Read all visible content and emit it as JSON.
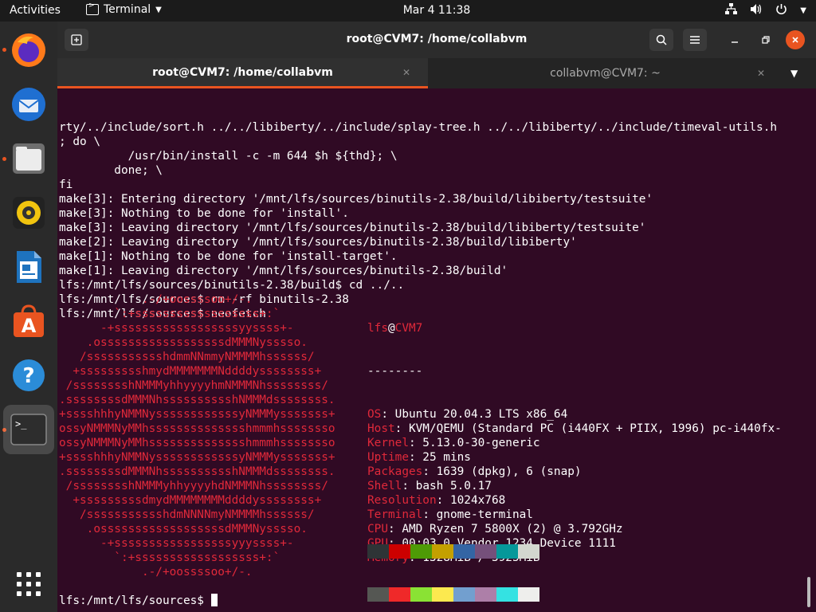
{
  "topbar": {
    "activities": "Activities",
    "app_name": "Terminal",
    "clock": "Mar 4  11:38",
    "tray_icons": [
      "network-icon",
      "volume-icon",
      "power-icon",
      "chevron-down-icon"
    ]
  },
  "dock": {
    "apps": [
      "firefox",
      "thunderbird",
      "files",
      "rhythmbox",
      "libreoffice-writer",
      "software",
      "help",
      "terminal",
      "show-applications"
    ]
  },
  "window": {
    "title": "root@CVM7: /home/collabvm",
    "tabs": [
      {
        "label": "root@CVM7: /home/collabvm",
        "active": true
      },
      {
        "label": "collabvm@CVM7: ~",
        "active": false
      }
    ]
  },
  "terminal": {
    "lines": [
      "rty/../include/sort.h ../../libiberty/../include/splay-tree.h ../../libiberty/../include/timeval-utils.h",
      "; do \\",
      "          /usr/bin/install -c -m 644 $h ${thd}; \\",
      "        done; \\",
      "fi",
      "make[3]: Entering directory '/mnt/lfs/sources/binutils-2.38/build/libiberty/testsuite'",
      "make[3]: Nothing to be done for 'install'.",
      "make[3]: Leaving directory '/mnt/lfs/sources/binutils-2.38/build/libiberty/testsuite'",
      "make[2]: Leaving directory '/mnt/lfs/sources/binutils-2.38/build/libiberty'",
      "make[1]: Nothing to be done for 'install-target'.",
      "make[1]: Leaving directory '/mnt/lfs/sources/binutils-2.38/build'",
      "lfs:/mnt/lfs/sources/binutils-2.38/build$ cd ../..",
      "lfs:/mnt/lfs/sources$ rm -rf binutils-2.38",
      "lfs:/mnt/lfs/sources$ neofetch"
    ],
    "art": [
      "            .-/+oossssoo+/-.",
      "        `:+ssssssssssssssssss+:`",
      "      -+ssssssssssssssssssyyssss+-",
      "    .ossssssssssssssssssdMMMNysssso.",
      "   /ssssssssssshdmmNNmmyNMMMMhssssss/",
      "  +ssssssssshmydMMMMMMMNddddyssssssss+",
      " /sssssssshNMMMyhhyyyyhmNMMMNhssssssss/",
      ".ssssssssdMMMNhsssssssssshNMMMdssssssss.",
      "+sssshhhyNMMNyssssssssssssyNMMMysssssss+",
      "ossyNMMMNyMMhsssssssssssssshmmmhssssssso",
      "ossyNMMMNyMMhsssssssssssssshmmmhssssssso",
      "+sssshhhyNMMNyssssssssssssyNMMMysssssss+",
      ".ssssssssdMMMNhsssssssssshNMMMdssssssss.",
      " /sssssssshNMMMyhhyyyyhdNMMMNhssssssss/",
      "  +sssssssssdmydMMMMMMMMddddyssssssss+",
      "   /ssssssssssshdmNNNNmyNMMMMhssssss/",
      "    .ossssssssssssssssssdMMMNysssso.",
      "      -+sssssssssssssssssyyyssss+-",
      "        `:+ssssssssssssssssss+:`",
      "            .-/+oossssoo+/-."
    ],
    "info": {
      "user": "lfs",
      "at": "@",
      "host": "CVM7",
      "separator": "--------",
      "fields": [
        {
          "key": "OS",
          "value": ": Ubuntu 20.04.3 LTS x86_64"
        },
        {
          "key": "Host",
          "value": ": KVM/QEMU (Standard PC (i440FX + PIIX, 1996) pc-i440fx-"
        },
        {
          "key": "Kernel",
          "value": ": 5.13.0-30-generic"
        },
        {
          "key": "Uptime",
          "value": ": 25 mins"
        },
        {
          "key": "Packages",
          "value": ": 1639 (dpkg), 6 (snap)"
        },
        {
          "key": "Shell",
          "value": ": bash 5.0.17"
        },
        {
          "key": "Resolution",
          "value": ": 1024x768"
        },
        {
          "key": "Terminal",
          "value": ": gnome-terminal"
        },
        {
          "key": "CPU",
          "value": ": AMD Ryzen 7 5800X (2) @ 3.792GHz"
        },
        {
          "key": "GPU",
          "value": ": 00:03.0 Vendor 1234 Device 1111"
        },
        {
          "key": "Memory",
          "value": ": 1328MiB / 3925MiB"
        }
      ]
    },
    "palette_top": [
      "#2e3436",
      "#cc0000",
      "#4e9a06",
      "#c4a000",
      "#3465a4",
      "#75507b",
      "#06989a",
      "#d3d7cf"
    ],
    "palette_bottom": [
      "#555753",
      "#ef2929",
      "#8ae234",
      "#fce94f",
      "#729fcf",
      "#ad7fa8",
      "#34e2e2",
      "#eeeeec"
    ],
    "prompt": "lfs:/mnt/lfs/sources$ "
  },
  "colors": {
    "accent": "#e95420",
    "terminal_bg": "#300a24",
    "ubuntu_red": "#e0293a"
  }
}
